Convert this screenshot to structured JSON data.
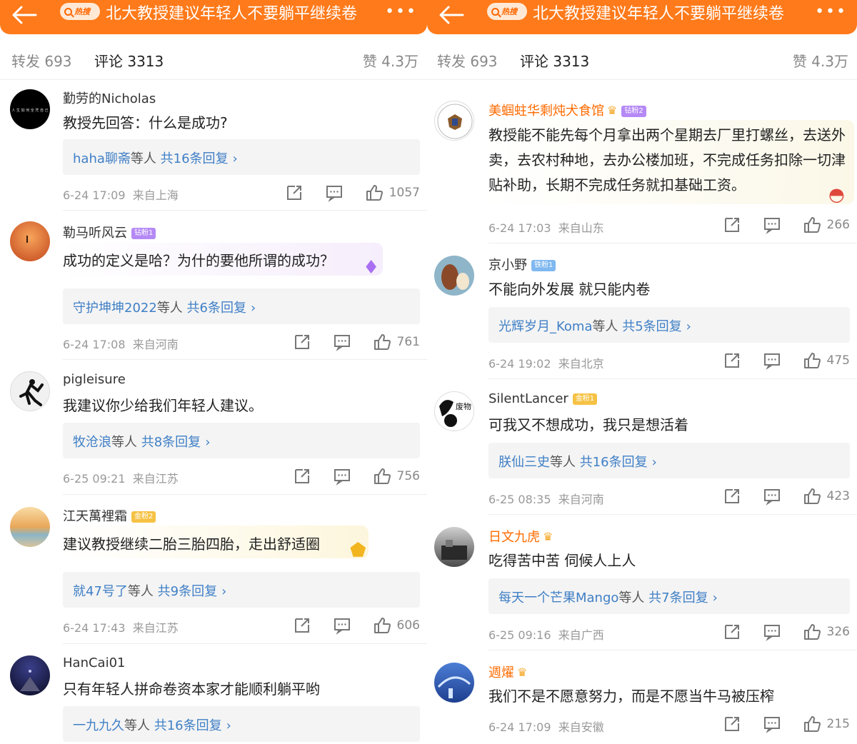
{
  "left": {
    "header": {
      "search_tag": "热搜",
      "title": "北大教授建议年轻人不要躺平继续卷",
      "more_label": "•••"
    },
    "tabs": {
      "repost": "转发 693",
      "comment": "评论 3313",
      "like": "赞 4.3万"
    },
    "comments": [
      {
        "nick": "勤劳的Nicholas",
        "text": "教授先回答：什么是成功?",
        "reply_user": "haha聊斋",
        "reply_suffix": "等人",
        "reply_count": "共16条回复",
        "time": "6-24 17:09",
        "location": "来自上海",
        "likes": "1057"
      },
      {
        "nick": "勒马听风云",
        "badge": "钻粉1",
        "text": "成功的定义是哈？为什的要他所谓的成功？",
        "reply_user": "守护坤坤2022",
        "reply_suffix": "等人",
        "reply_count": "共6条回复",
        "time": "6-24 17:08",
        "location": "来自河南",
        "likes": "761"
      },
      {
        "nick": "pigleisure",
        "text": "我建议你少给我们年轻人建议。",
        "reply_user": "牧沧浪",
        "reply_suffix": "等人",
        "reply_count": "共8条回复",
        "time": "6-25 09:21",
        "location": "来自江苏",
        "likes": "756"
      },
      {
        "nick": "江天萬裡霜",
        "badge": "金粉2",
        "text": "建议教授继续二胎三胎四胎，走出舒适圈",
        "reply_user": "就47号了",
        "reply_suffix": "等人",
        "reply_count": "共9条回复",
        "time": "6-24 17:43",
        "location": "来自江苏",
        "likes": "606"
      },
      {
        "nick": "HanCai01",
        "text": "只有年轻人拼命卷资本家才能顺利躺平哟",
        "reply_user": "一九九久",
        "reply_suffix": "等人",
        "reply_count": "共16条回复"
      }
    ]
  },
  "right": {
    "header": {
      "search_tag": "热搜",
      "title": "北大教授建议年轻人不要躺平继续卷",
      "more_label": "•••"
    },
    "tabs": {
      "repost": "转发 693",
      "comment": "评论 3313",
      "like": "赞 4.3万"
    },
    "comments": [
      {
        "nick": "美蝈蛀华剩炖犬食馆",
        "badge": "钻粉2",
        "text": "教授能不能先每个月拿出两个星期去厂里打螺丝，去送外卖，去农村种地，去办公楼加班，不完成任务扣除一切津贴补助，长期不完成任务就扣基础工资。",
        "time": "6-24 17:03",
        "location": "来自山东",
        "likes": "266"
      },
      {
        "nick": "京小野",
        "badge": "铁粉1",
        "text": "不能向外发展 就只能内卷",
        "reply_user": "光辉岁月_Koma",
        "reply_suffix": "等人",
        "reply_count": "共5条回复",
        "time": "6-24 19:02",
        "location": "来自北京",
        "likes": "475"
      },
      {
        "nick": "SilentLancer",
        "badge": "金粉1",
        "avatar_text": "废物",
        "text": "可我又不想成功，我只是想活着",
        "reply_user": "朕仙三史",
        "reply_suffix": "等人",
        "reply_count": "共16条回复",
        "time": "6-25 08:35",
        "location": "来自河南",
        "likes": "423"
      },
      {
        "nick": "日文九虎",
        "text": "吃得苦中苦 伺候人上人",
        "reply_user": "每天一个芒果Mango",
        "reply_suffix": "等人",
        "reply_count": "共7条回复",
        "time": "6-25 09:16",
        "location": "来自广西",
        "likes": "326"
      },
      {
        "nick": "週燿",
        "text": "我们不是不愿意努力，而是不愿当牛马被压榨",
        "time": "6-24 17:09",
        "location": "来自安徽",
        "likes": "215"
      }
    ]
  },
  "colors": {
    "header": "#ff7a1a",
    "link": "#3f7fc6",
    "nick_highlight": "#ff6b00"
  },
  "icons": [
    "back-arrow-icon",
    "search-icon",
    "more-icon",
    "share-icon",
    "comment-icon",
    "like-icon",
    "chevron-right-icon",
    "crown-icon"
  ]
}
